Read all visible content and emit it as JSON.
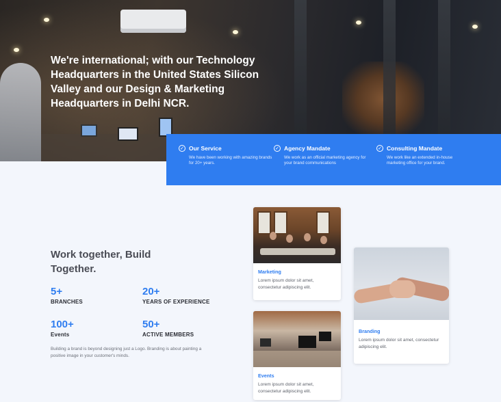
{
  "hero": {
    "headline": "We're international; with our Technology Headquarters in the United States Silicon Valley and our Design & Marketing Headquarters in Delhi NCR."
  },
  "services": [
    {
      "icon": "check-circle-icon",
      "title": "Our Service",
      "desc": "We have been working with amazing brands for 20+ years."
    },
    {
      "icon": "check-circle-icon",
      "title": "Agency Mandate",
      "desc": "We work as an official marketing agency for your brand communications"
    },
    {
      "icon": "check-circle-icon",
      "title": "Consulting Mandate",
      "desc": "We work like an extended in-house marketing office for your brand."
    }
  ],
  "about": {
    "headline": "Work together, Build Together.",
    "stats": [
      {
        "number": "5+",
        "label": "BRANCHES"
      },
      {
        "number": "20+",
        "label": "YEARS OF EXPERIENCE"
      },
      {
        "number": "100+",
        "label": "Events"
      },
      {
        "number": "50+",
        "label": "ACTIVE MEMBERS"
      }
    ],
    "blurb": "Building a brand is beyond designing just a Logo. Branding is about painting a positive image in your customer's minds."
  },
  "cards": [
    {
      "title": "Marketing",
      "text": "Lorem ipsum dolor sit amet, consectetur adipiscing elit."
    },
    {
      "title": "Events",
      "text": "Lorem ipsum dolor sit amet, consectetur adipiscing elit."
    },
    {
      "title": "Branding",
      "text": "Lorem ipsum dolor sit amet, consectetur adipiscing elit."
    }
  ],
  "colors": {
    "accent": "#2f7df0",
    "background": "#f3f6fc",
    "heading": "#4a4c55"
  }
}
